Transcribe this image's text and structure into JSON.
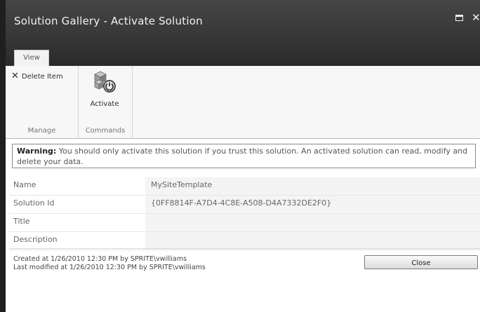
{
  "window": {
    "title": "Solution Gallery - Activate Solution",
    "maximize_icon": "maximize-icon",
    "close_icon": "close-icon"
  },
  "ribbon": {
    "tabs": [
      {
        "label": "View",
        "selected": true
      }
    ],
    "groups": [
      {
        "label": "Manage",
        "buttons": [
          {
            "label": "Delete Item",
            "icon": "x-icon"
          }
        ]
      },
      {
        "label": "Commands",
        "buttons": [
          {
            "label": "Activate",
            "icon": "activate-icon"
          }
        ]
      }
    ]
  },
  "warning": {
    "prefix": "Warning:",
    "text": " You should only activate this solution if you trust this solution. An activated solution can read, modify and delete your data."
  },
  "properties": [
    {
      "label": "Name",
      "value": "MySiteTemplate"
    },
    {
      "label": "Solution Id",
      "value": "{0FF8814F-A7D4-4C8E-A508-D4A7332DE2F0}"
    },
    {
      "label": "Title",
      "value": ""
    },
    {
      "label": "Description",
      "value": ""
    }
  ],
  "footer": {
    "created": "Created at 1/26/2010 12:30 PM by SPRITE\\vwilliams",
    "modified": "Last modified at 1/26/2010 12:30 PM by SPRITE\\vwilliams",
    "close_label": "Close"
  },
  "colors": {
    "title_bar": "#3a3a3a",
    "ribbon_bg": "#f7f7f7",
    "value_cell_bg": "#f4f4f4"
  }
}
